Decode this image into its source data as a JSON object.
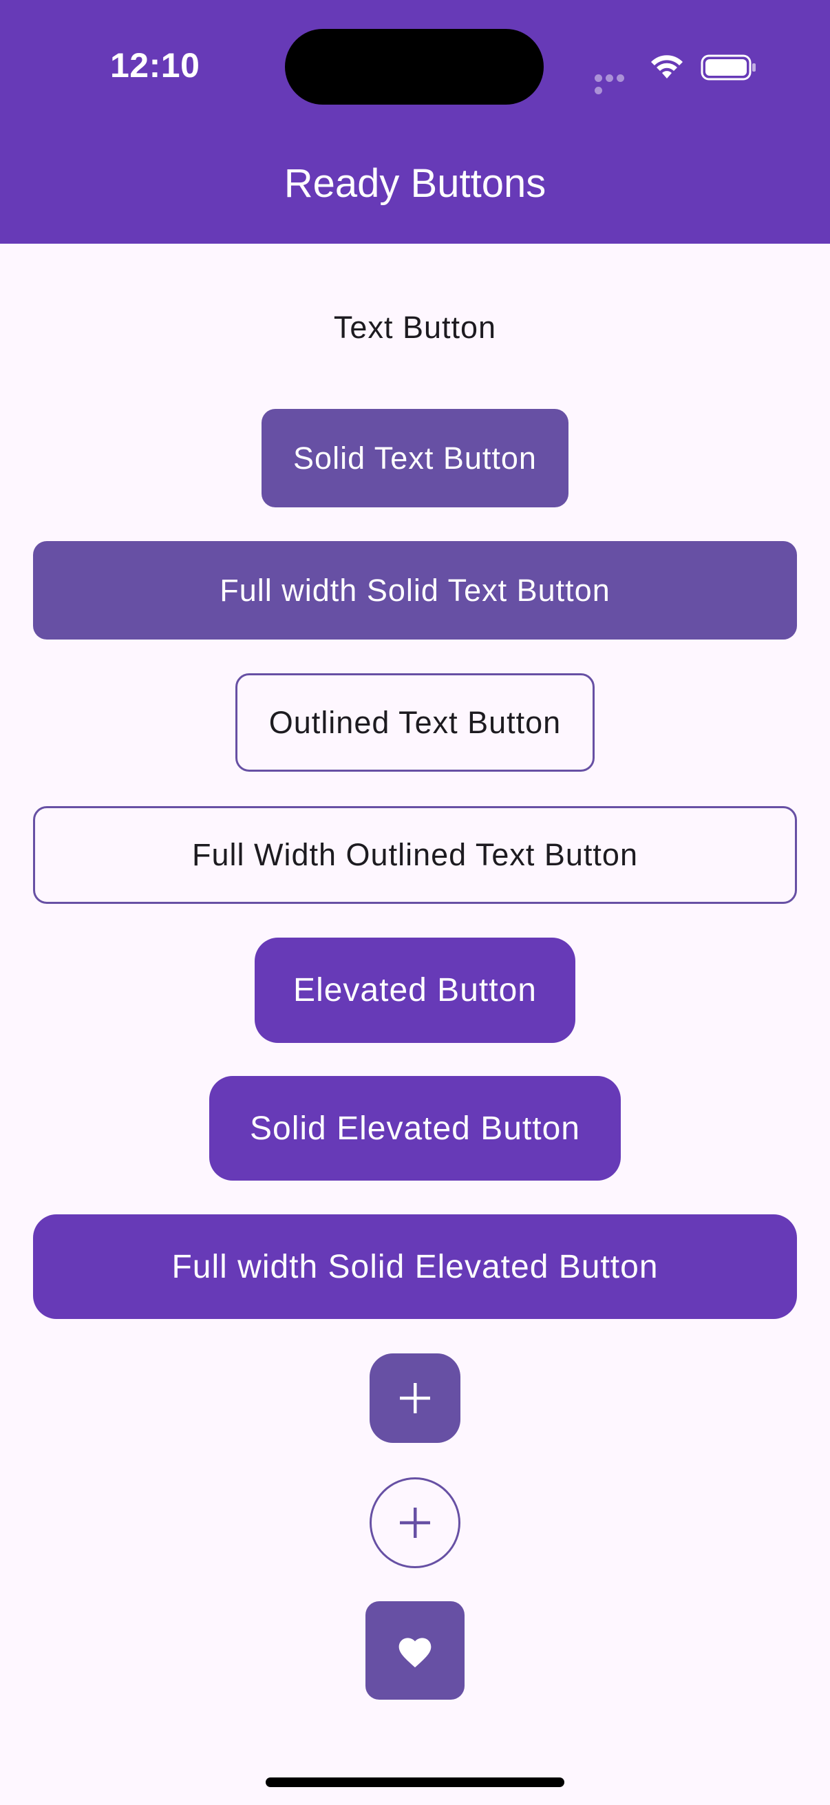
{
  "status_bar": {
    "time": "12:10"
  },
  "app_bar": {
    "title": "Ready Buttons",
    "background_color": "#673ab7"
  },
  "buttons": {
    "text_button": "Text Button",
    "solid_text_button": "Solid Text Button",
    "full_width_solid_text_button": "Full width Solid Text Button",
    "outlined_text_button": "Outlined Text Button",
    "full_width_outlined_text_button": "Full Width Outlined Text Button",
    "elevated_button": "Elevated Button",
    "solid_elevated_button": "Solid Elevated Button",
    "full_width_solid_elevated_button": "Full width Solid Elevated Button"
  },
  "icon_buttons": [
    {
      "icon": "plus-icon",
      "style": "solid"
    },
    {
      "icon": "plus-icon",
      "style": "outlined"
    },
    {
      "icon": "heart-icon",
      "style": "solid"
    }
  ],
  "colors": {
    "primary": "#6750a4",
    "accent": "#673ab7",
    "background": "#fef7ff",
    "on_primary": "#ffffff",
    "text": "#1d1b20"
  }
}
